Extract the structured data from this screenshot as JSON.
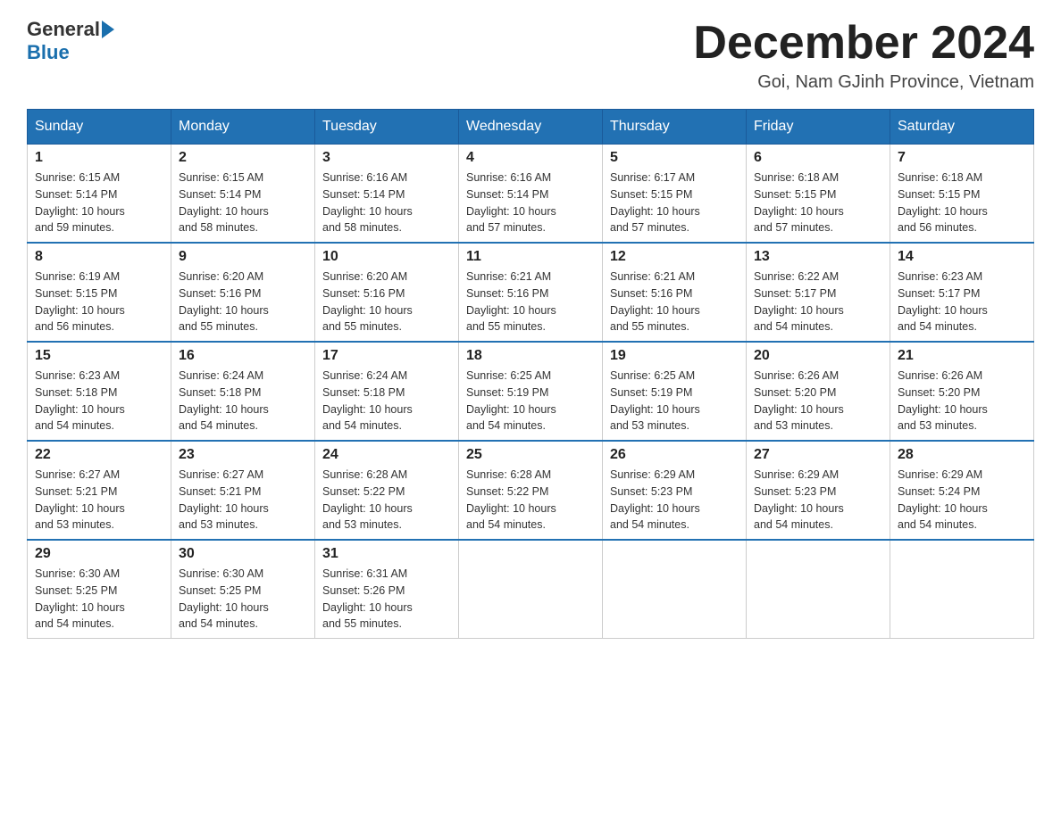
{
  "header": {
    "logo_general": "General",
    "logo_blue": "Blue",
    "title": "December 2024",
    "subtitle": "Goi, Nam GJinh Province, Vietnam"
  },
  "weekdays": [
    "Sunday",
    "Monday",
    "Tuesday",
    "Wednesday",
    "Thursday",
    "Friday",
    "Saturday"
  ],
  "weeks": [
    [
      {
        "day": "1",
        "sunrise": "6:15 AM",
        "sunset": "5:14 PM",
        "daylight": "10 hours and 59 minutes."
      },
      {
        "day": "2",
        "sunrise": "6:15 AM",
        "sunset": "5:14 PM",
        "daylight": "10 hours and 58 minutes."
      },
      {
        "day": "3",
        "sunrise": "6:16 AM",
        "sunset": "5:14 PM",
        "daylight": "10 hours and 58 minutes."
      },
      {
        "day": "4",
        "sunrise": "6:16 AM",
        "sunset": "5:14 PM",
        "daylight": "10 hours and 57 minutes."
      },
      {
        "day": "5",
        "sunrise": "6:17 AM",
        "sunset": "5:15 PM",
        "daylight": "10 hours and 57 minutes."
      },
      {
        "day": "6",
        "sunrise": "6:18 AM",
        "sunset": "5:15 PM",
        "daylight": "10 hours and 57 minutes."
      },
      {
        "day": "7",
        "sunrise": "6:18 AM",
        "sunset": "5:15 PM",
        "daylight": "10 hours and 56 minutes."
      }
    ],
    [
      {
        "day": "8",
        "sunrise": "6:19 AM",
        "sunset": "5:15 PM",
        "daylight": "10 hours and 56 minutes."
      },
      {
        "day": "9",
        "sunrise": "6:20 AM",
        "sunset": "5:16 PM",
        "daylight": "10 hours and 55 minutes."
      },
      {
        "day": "10",
        "sunrise": "6:20 AM",
        "sunset": "5:16 PM",
        "daylight": "10 hours and 55 minutes."
      },
      {
        "day": "11",
        "sunrise": "6:21 AM",
        "sunset": "5:16 PM",
        "daylight": "10 hours and 55 minutes."
      },
      {
        "day": "12",
        "sunrise": "6:21 AM",
        "sunset": "5:16 PM",
        "daylight": "10 hours and 55 minutes."
      },
      {
        "day": "13",
        "sunrise": "6:22 AM",
        "sunset": "5:17 PM",
        "daylight": "10 hours and 54 minutes."
      },
      {
        "day": "14",
        "sunrise": "6:23 AM",
        "sunset": "5:17 PM",
        "daylight": "10 hours and 54 minutes."
      }
    ],
    [
      {
        "day": "15",
        "sunrise": "6:23 AM",
        "sunset": "5:18 PM",
        "daylight": "10 hours and 54 minutes."
      },
      {
        "day": "16",
        "sunrise": "6:24 AM",
        "sunset": "5:18 PM",
        "daylight": "10 hours and 54 minutes."
      },
      {
        "day": "17",
        "sunrise": "6:24 AM",
        "sunset": "5:18 PM",
        "daylight": "10 hours and 54 minutes."
      },
      {
        "day": "18",
        "sunrise": "6:25 AM",
        "sunset": "5:19 PM",
        "daylight": "10 hours and 54 minutes."
      },
      {
        "day": "19",
        "sunrise": "6:25 AM",
        "sunset": "5:19 PM",
        "daylight": "10 hours and 53 minutes."
      },
      {
        "day": "20",
        "sunrise": "6:26 AM",
        "sunset": "5:20 PM",
        "daylight": "10 hours and 53 minutes."
      },
      {
        "day": "21",
        "sunrise": "6:26 AM",
        "sunset": "5:20 PM",
        "daylight": "10 hours and 53 minutes."
      }
    ],
    [
      {
        "day": "22",
        "sunrise": "6:27 AM",
        "sunset": "5:21 PM",
        "daylight": "10 hours and 53 minutes."
      },
      {
        "day": "23",
        "sunrise": "6:27 AM",
        "sunset": "5:21 PM",
        "daylight": "10 hours and 53 minutes."
      },
      {
        "day": "24",
        "sunrise": "6:28 AM",
        "sunset": "5:22 PM",
        "daylight": "10 hours and 53 minutes."
      },
      {
        "day": "25",
        "sunrise": "6:28 AM",
        "sunset": "5:22 PM",
        "daylight": "10 hours and 54 minutes."
      },
      {
        "day": "26",
        "sunrise": "6:29 AM",
        "sunset": "5:23 PM",
        "daylight": "10 hours and 54 minutes."
      },
      {
        "day": "27",
        "sunrise": "6:29 AM",
        "sunset": "5:23 PM",
        "daylight": "10 hours and 54 minutes."
      },
      {
        "day": "28",
        "sunrise": "6:29 AM",
        "sunset": "5:24 PM",
        "daylight": "10 hours and 54 minutes."
      }
    ],
    [
      {
        "day": "29",
        "sunrise": "6:30 AM",
        "sunset": "5:25 PM",
        "daylight": "10 hours and 54 minutes."
      },
      {
        "day": "30",
        "sunrise": "6:30 AM",
        "sunset": "5:25 PM",
        "daylight": "10 hours and 54 minutes."
      },
      {
        "day": "31",
        "sunrise": "6:31 AM",
        "sunset": "5:26 PM",
        "daylight": "10 hours and 55 minutes."
      },
      null,
      null,
      null,
      null
    ]
  ],
  "labels": {
    "sunrise": "Sunrise:",
    "sunset": "Sunset:",
    "daylight": "Daylight:"
  }
}
